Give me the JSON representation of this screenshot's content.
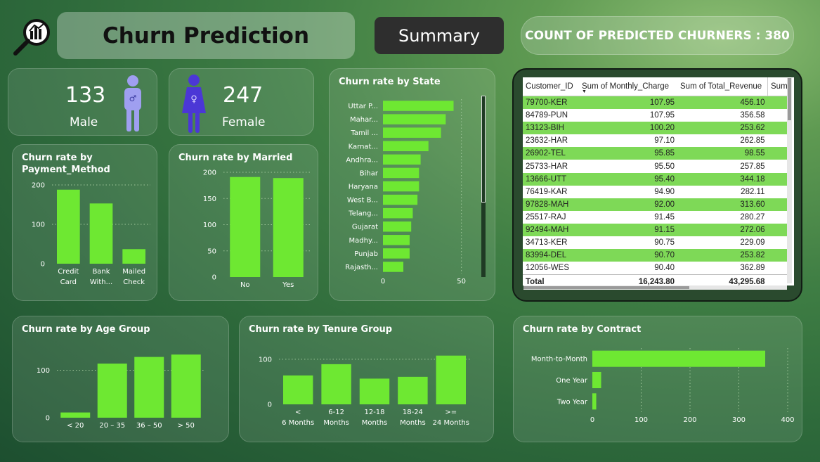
{
  "header": {
    "title": "Churn Prediction",
    "summary_button": "Summary",
    "count_label": "COUNT OF PREDICTED CHURNERS : 380",
    "logo_icon": "magnifier-chart-icon"
  },
  "gender": {
    "male_count": "133",
    "male_label": "Male",
    "female_count": "247",
    "female_label": "Female",
    "male_icon_color": "#9f9ff0",
    "female_icon_color": "#4b37d6"
  },
  "colors": {
    "bar": "#6ee832",
    "accent_dark": "#2e2e2e"
  },
  "chart_data": [
    {
      "id": "payment",
      "type": "bar",
      "title": "Churn rate by Payment_Method",
      "categories": [
        "Credit Card",
        "Bank With...",
        "Mailed Check"
      ],
      "values": [
        188,
        153,
        37
      ],
      "ylim": [
        0,
        200
      ],
      "yticks": [
        0,
        100,
        200
      ]
    },
    {
      "id": "married",
      "type": "bar",
      "title": "Churn rate by Married",
      "categories": [
        "No",
        "Yes"
      ],
      "values": [
        191,
        189
      ],
      "ylim": [
        0,
        200
      ],
      "yticks": [
        0,
        50,
        100,
        150,
        200
      ]
    },
    {
      "id": "state",
      "type": "bar",
      "orientation": "horizontal",
      "title": "Churn rate by State",
      "categories": [
        "Uttar P...",
        "Mahar...",
        "Tamil ...",
        "Karnat...",
        "Andhra...",
        "Bihar",
        "Haryana",
        "West B...",
        "Telang...",
        "Gujarat",
        "Madhy...",
        "Punjab",
        "Rajasth..."
      ],
      "values": [
        45,
        40,
        37,
        29,
        24,
        23,
        23,
        22,
        19,
        18,
        17,
        17,
        13
      ],
      "xlim": [
        0,
        60
      ],
      "xticks": [
        0,
        50
      ]
    },
    {
      "id": "age",
      "type": "bar",
      "title": "Churn rate by Age Group",
      "categories": [
        "< 20",
        "20 – 35",
        "36 – 50",
        "> 50"
      ],
      "values": [
        11,
        114,
        128,
        133
      ],
      "ylim": [
        0,
        160
      ],
      "yticks": [
        0,
        100
      ]
    },
    {
      "id": "tenure",
      "type": "bar",
      "title": "Churn rate by Tenure Group",
      "categories": [
        "< 6 Months",
        "6-12 Months",
        "12-18 Months",
        "18-24 Months",
        ">= 24 Months"
      ],
      "values": [
        64,
        89,
        57,
        61,
        108
      ],
      "ylim": [
        0,
        120
      ],
      "yticks": [
        0,
        100
      ]
    },
    {
      "id": "contract",
      "type": "bar",
      "orientation": "horizontal",
      "title": "Churn rate by Contract",
      "categories": [
        "Month-to-Month",
        "One Year",
        "Two Year"
      ],
      "values": [
        354,
        18,
        8
      ],
      "xlim": [
        0,
        400
      ],
      "xticks": [
        0,
        100,
        200,
        300,
        400
      ]
    }
  ],
  "table": {
    "columns": [
      "Customer_ID",
      "Sum of Monthly_Charge",
      "Sum of Total_Revenue",
      "Sum"
    ],
    "rows": [
      [
        "79700-KER",
        "107.95",
        "456.10"
      ],
      [
        "84789-PUN",
        "107.95",
        "356.58"
      ],
      [
        "13123-BIH",
        "100.20",
        "253.62"
      ],
      [
        "23632-HAR",
        "97.10",
        "262.85"
      ],
      [
        "26902-TEL",
        "95.85",
        "98.55"
      ],
      [
        "25733-HAR",
        "95.50",
        "257.85"
      ],
      [
        "13666-UTT",
        "95.40",
        "344.18"
      ],
      [
        "76419-KAR",
        "94.90",
        "282.11"
      ],
      [
        "97828-MAH",
        "92.00",
        "313.60"
      ],
      [
        "25517-RAJ",
        "91.45",
        "280.27"
      ],
      [
        "92494-MAH",
        "91.15",
        "272.06"
      ],
      [
        "34713-KER",
        "90.75",
        "229.09"
      ],
      [
        "83994-DEL",
        "90.70",
        "253.82"
      ],
      [
        "12056-WES",
        "90.40",
        "362.89"
      ]
    ],
    "total_label": "Total",
    "total_monthly": "16,243.80",
    "total_revenue": "43,295.68"
  }
}
